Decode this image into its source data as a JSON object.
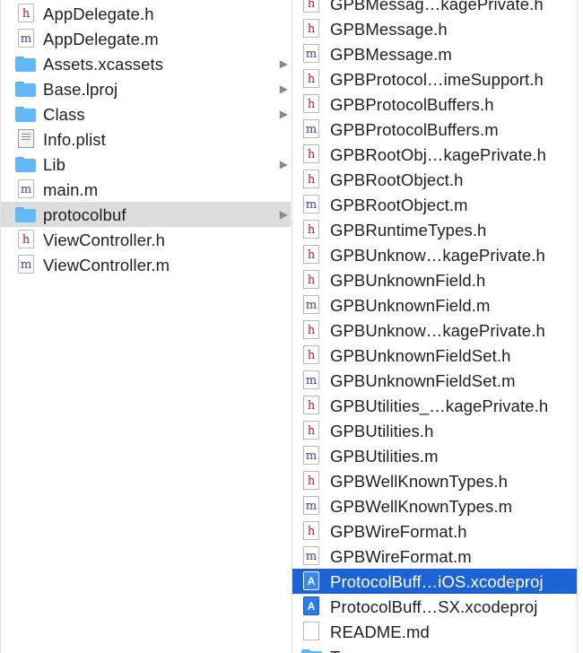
{
  "column1": {
    "items": [
      {
        "label": "AppDelegate.h",
        "icon": "h-file-icon",
        "icon_text": "h"
      },
      {
        "label": "AppDelegate.m",
        "icon": "m-file-icon",
        "icon_text": "m"
      },
      {
        "label": "Assets.xcassets",
        "icon": "folder-icon",
        "has_children": true
      },
      {
        "label": "Base.lproj",
        "icon": "folder-icon",
        "has_children": true
      },
      {
        "label": "Class",
        "icon": "folder-icon",
        "has_children": true
      },
      {
        "label": "Info.plist",
        "icon": "plist-file-icon"
      },
      {
        "label": "Lib",
        "icon": "folder-icon",
        "has_children": true
      },
      {
        "label": "main.m",
        "icon": "m-file-icon",
        "icon_text": "m"
      },
      {
        "label": "protocolbuf",
        "icon": "folder-icon",
        "has_children": true,
        "selected": true
      },
      {
        "label": "ViewController.h",
        "icon": "h-file-icon",
        "icon_text": "h"
      },
      {
        "label": "ViewController.m",
        "icon": "m-file-icon",
        "icon_text": "m"
      }
    ]
  },
  "column2": {
    "items": [
      {
        "label": "GPBMessag…kagePrivate.h",
        "icon": "h-file-icon",
        "icon_text": "h"
      },
      {
        "label": "GPBMessage.h",
        "icon": "h-file-icon",
        "icon_text": "h"
      },
      {
        "label": "GPBMessage.m",
        "icon": "m-file-icon",
        "icon_text": "m"
      },
      {
        "label": "GPBProtocol…imeSupport.h",
        "icon": "h-file-icon",
        "icon_text": "h"
      },
      {
        "label": "GPBProtocolBuffers.h",
        "icon": "h-file-icon",
        "icon_text": "h"
      },
      {
        "label": "GPBProtocolBuffers.m",
        "icon": "m-file-icon",
        "icon_text": "m"
      },
      {
        "label": "GPBRootObj…kagePrivate.h",
        "icon": "h-file-icon",
        "icon_text": "h"
      },
      {
        "label": "GPBRootObject.h",
        "icon": "h-file-icon",
        "icon_text": "h"
      },
      {
        "label": "GPBRootObject.m",
        "icon": "m-file-icon",
        "icon_text": "m"
      },
      {
        "label": "GPBRuntimeTypes.h",
        "icon": "h-file-icon",
        "icon_text": "h"
      },
      {
        "label": "GPBUnknow…kagePrivate.h",
        "icon": "h-file-icon",
        "icon_text": "h"
      },
      {
        "label": "GPBUnknownField.h",
        "icon": "h-file-icon",
        "icon_text": "h"
      },
      {
        "label": "GPBUnknownField.m",
        "icon": "m-file-icon",
        "icon_text": "m"
      },
      {
        "label": "GPBUnknow…kagePrivate.h",
        "icon": "h-file-icon",
        "icon_text": "h"
      },
      {
        "label": "GPBUnknownFieldSet.h",
        "icon": "h-file-icon",
        "icon_text": "h"
      },
      {
        "label": "GPBUnknownFieldSet.m",
        "icon": "m-file-icon",
        "icon_text": "m"
      },
      {
        "label": "GPBUtilities_…kagePrivate.h",
        "icon": "h-file-icon",
        "icon_text": "h"
      },
      {
        "label": "GPBUtilities.h",
        "icon": "h-file-icon",
        "icon_text": "h"
      },
      {
        "label": "GPBUtilities.m",
        "icon": "m-file-icon",
        "icon_text": "m"
      },
      {
        "label": "GPBWellKnownTypes.h",
        "icon": "h-file-icon",
        "icon_text": "h"
      },
      {
        "label": "GPBWellKnownTypes.m",
        "icon": "m-file-icon",
        "icon_text": "m"
      },
      {
        "label": "GPBWireFormat.h",
        "icon": "h-file-icon",
        "icon_text": "h"
      },
      {
        "label": "GPBWireFormat.m",
        "icon": "m-file-icon",
        "icon_text": "m"
      },
      {
        "label": "ProtocolBuff…iOS.xcodeproj",
        "icon": "xcodeproj-icon",
        "selected": true
      },
      {
        "label": "ProtocolBuff…SX.xcodeproj",
        "icon": "xcodeproj-icon"
      },
      {
        "label": "README.md",
        "icon": "document-icon"
      },
      {
        "label": "T",
        "icon": "folder-icon",
        "has_children": true,
        "partially_visible": true
      }
    ]
  },
  "colors": {
    "selected_inactive": "#dcdcdc",
    "selected_active": "#1e63d5",
    "folder": "#63b9f5",
    "h_icon_letter": "#b3222b",
    "m_icon_letter": "#4b3b8c"
  }
}
